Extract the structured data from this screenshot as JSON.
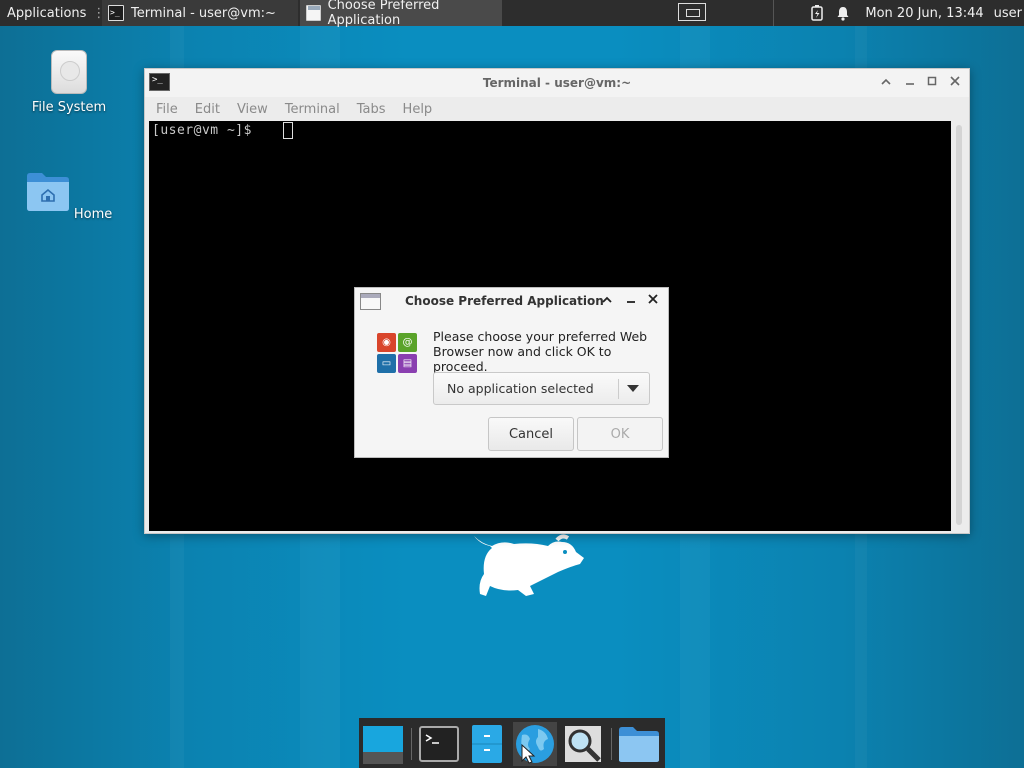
{
  "top_panel": {
    "applications_label": "Applications",
    "tasks": [
      {
        "label": "Terminal - user@vm:~",
        "icon": "terminal-icon"
      },
      {
        "label": "Choose Preferred Application",
        "icon": "window-icon"
      }
    ],
    "clock": "Mon 20 Jun, 13:44",
    "user": "user"
  },
  "desktop": {
    "icons": [
      {
        "label": "File System",
        "icon": "drive-icon"
      },
      {
        "label": "Home",
        "icon": "home-folder-icon"
      }
    ]
  },
  "terminal": {
    "title": "Terminal - user@vm:~",
    "menu": [
      "File",
      "Edit",
      "View",
      "Terminal",
      "Tabs",
      "Help"
    ],
    "prompt": "[user@vm ~]$"
  },
  "dialog": {
    "title": "Choose Preferred Application",
    "message": "Please choose your preferred Web Browser now and click OK to proceed.",
    "select_value": "No application selected",
    "cancel_label": "Cancel",
    "ok_label": "OK"
  },
  "dock": {
    "items": [
      "show-desktop",
      "terminal",
      "file-manager",
      "web-browser",
      "app-finder",
      "home-folder"
    ]
  },
  "colors": {
    "desktop_bg": "#0a8ec0",
    "panel_bg": "#2d2d2d",
    "terminal_bg": "#000000"
  }
}
